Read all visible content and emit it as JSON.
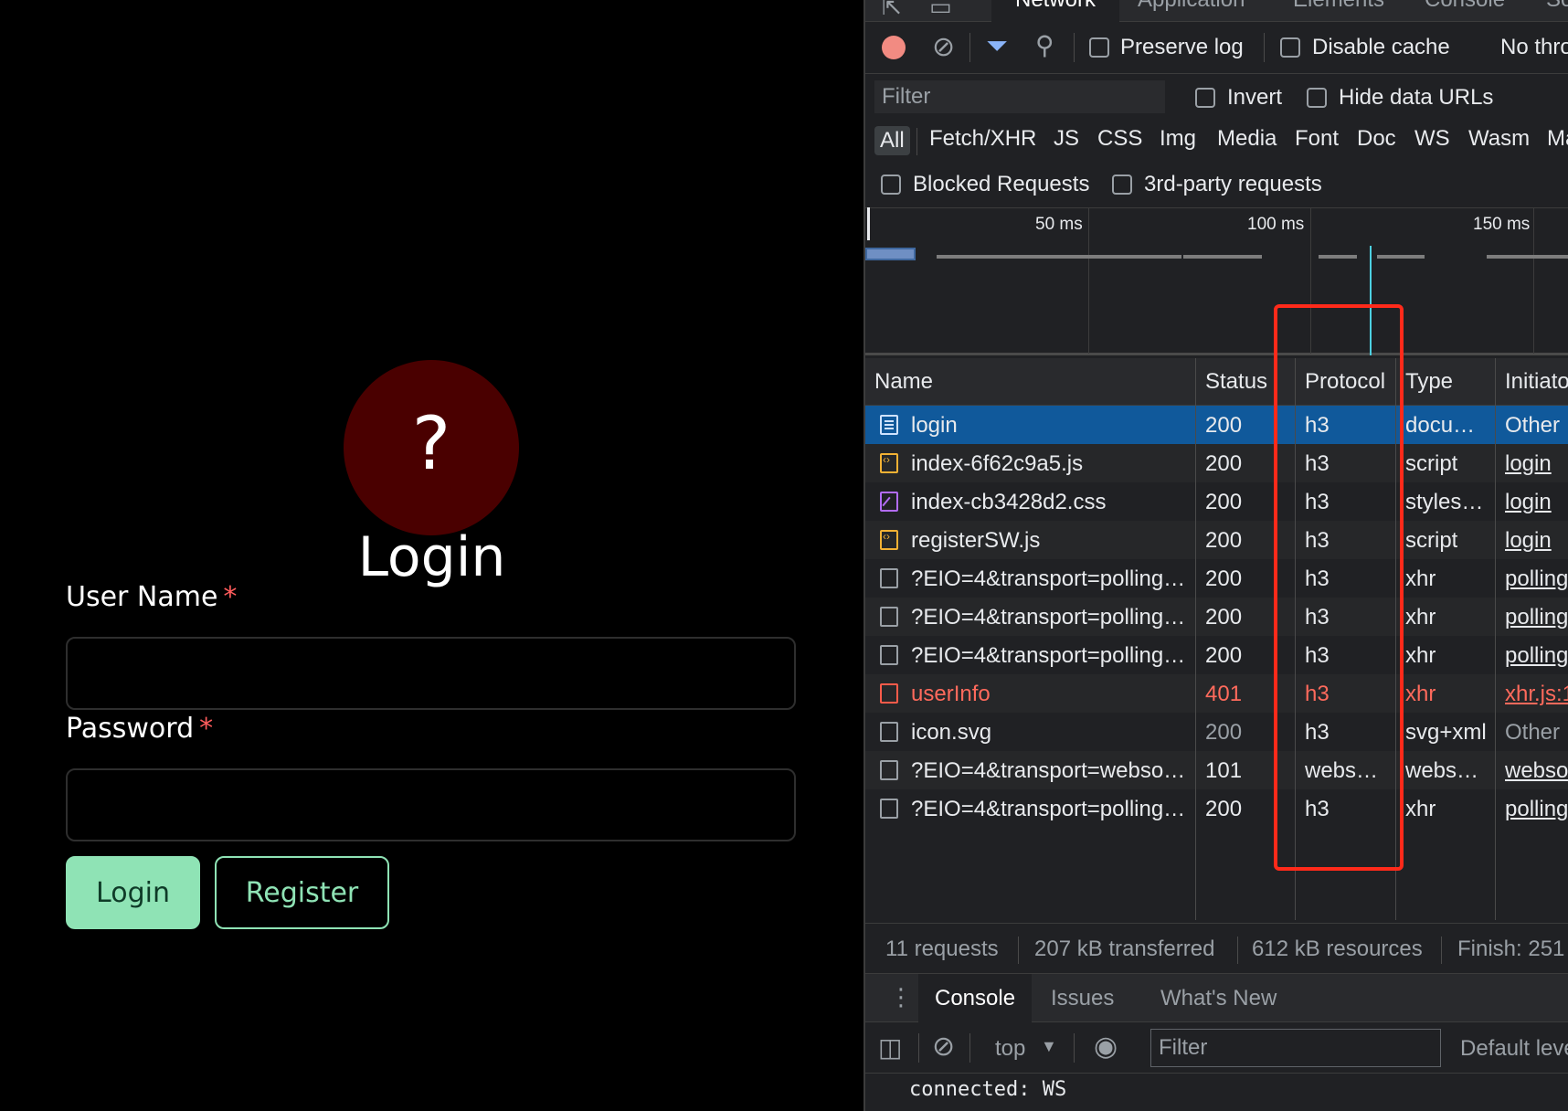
{
  "app": {
    "avatar_symbol": "?",
    "title": "Login",
    "username_label": "User Name",
    "password_label": "Password",
    "required_mark": "*",
    "login_button": "Login",
    "register_button": "Register",
    "accent_color": "#8fe3b5",
    "avatar_color": "#4a0000"
  },
  "devtools": {
    "main_tabs": [
      "Network",
      "Application",
      "Elements",
      "Console",
      "So"
    ],
    "toolbar": {
      "preserve_log": "Preserve log",
      "disable_cache": "Disable cache",
      "throttling": "No thro"
    },
    "filter": {
      "placeholder": "Filter",
      "invert": "Invert",
      "hide_data_urls": "Hide data URLs"
    },
    "type_filters": [
      "All",
      "Fetch/XHR",
      "JS",
      "CSS",
      "Img",
      "Media",
      "Font",
      "Doc",
      "WS",
      "Wasm",
      "Ma"
    ],
    "blocked_requests": "Blocked Requests",
    "third_party": "3rd-party requests",
    "timeline_ticks": [
      "50 ms",
      "100 ms",
      "150 ms"
    ],
    "columns": [
      "Name",
      "Status",
      "Protocol",
      "Type",
      "Initiato"
    ],
    "rows": [
      {
        "name": "login",
        "status": "200",
        "protocol": "h3",
        "type": "docu…",
        "initiator": "Other",
        "icon": "doc"
      },
      {
        "name": "index-6f62c9a5.js",
        "status": "200",
        "protocol": "h3",
        "type": "script",
        "initiator": "login",
        "icon": "js"
      },
      {
        "name": "index-cb3428d2.css",
        "status": "200",
        "protocol": "h3",
        "type": "styles…",
        "initiator": "login",
        "icon": "css"
      },
      {
        "name": "registerSW.js",
        "status": "200",
        "protocol": "h3",
        "type": "script",
        "initiator": "login",
        "icon": "js"
      },
      {
        "name": "?EIO=4&transport=polling…",
        "status": "200",
        "protocol": "h3",
        "type": "xhr",
        "initiator": "polling",
        "icon": "blank"
      },
      {
        "name": "?EIO=4&transport=polling…",
        "status": "200",
        "protocol": "h3",
        "type": "xhr",
        "initiator": "polling",
        "icon": "blank"
      },
      {
        "name": "?EIO=4&transport=polling…",
        "status": "200",
        "protocol": "h3",
        "type": "xhr",
        "initiator": "polling",
        "icon": "blank"
      },
      {
        "name": "userInfo",
        "status": "401",
        "protocol": "h3",
        "type": "xhr",
        "initiator": "xhr.js:1",
        "icon": "err"
      },
      {
        "name": "icon.svg",
        "status": "200",
        "protocol": "h3",
        "type": "svg+xml",
        "initiator": "Other",
        "icon": "blank"
      },
      {
        "name": "?EIO=4&transport=webso…",
        "status": "101",
        "protocol": "webs…",
        "type": "webs…",
        "initiator": "webso",
        "icon": "blank"
      },
      {
        "name": "?EIO=4&transport=polling…",
        "status": "200",
        "protocol": "h3",
        "type": "xhr",
        "initiator": "polling",
        "icon": "blank"
      }
    ],
    "statusbar": [
      "11 requests",
      "207 kB transferred",
      "612 kB resources",
      "Finish: 251"
    ],
    "drawer_tabs": [
      "Console",
      "Issues",
      "What's New"
    ],
    "console_context": "top",
    "console_filter_placeholder": "Filter",
    "log_levels": "Default leve",
    "console_output": "connected: WS"
  }
}
